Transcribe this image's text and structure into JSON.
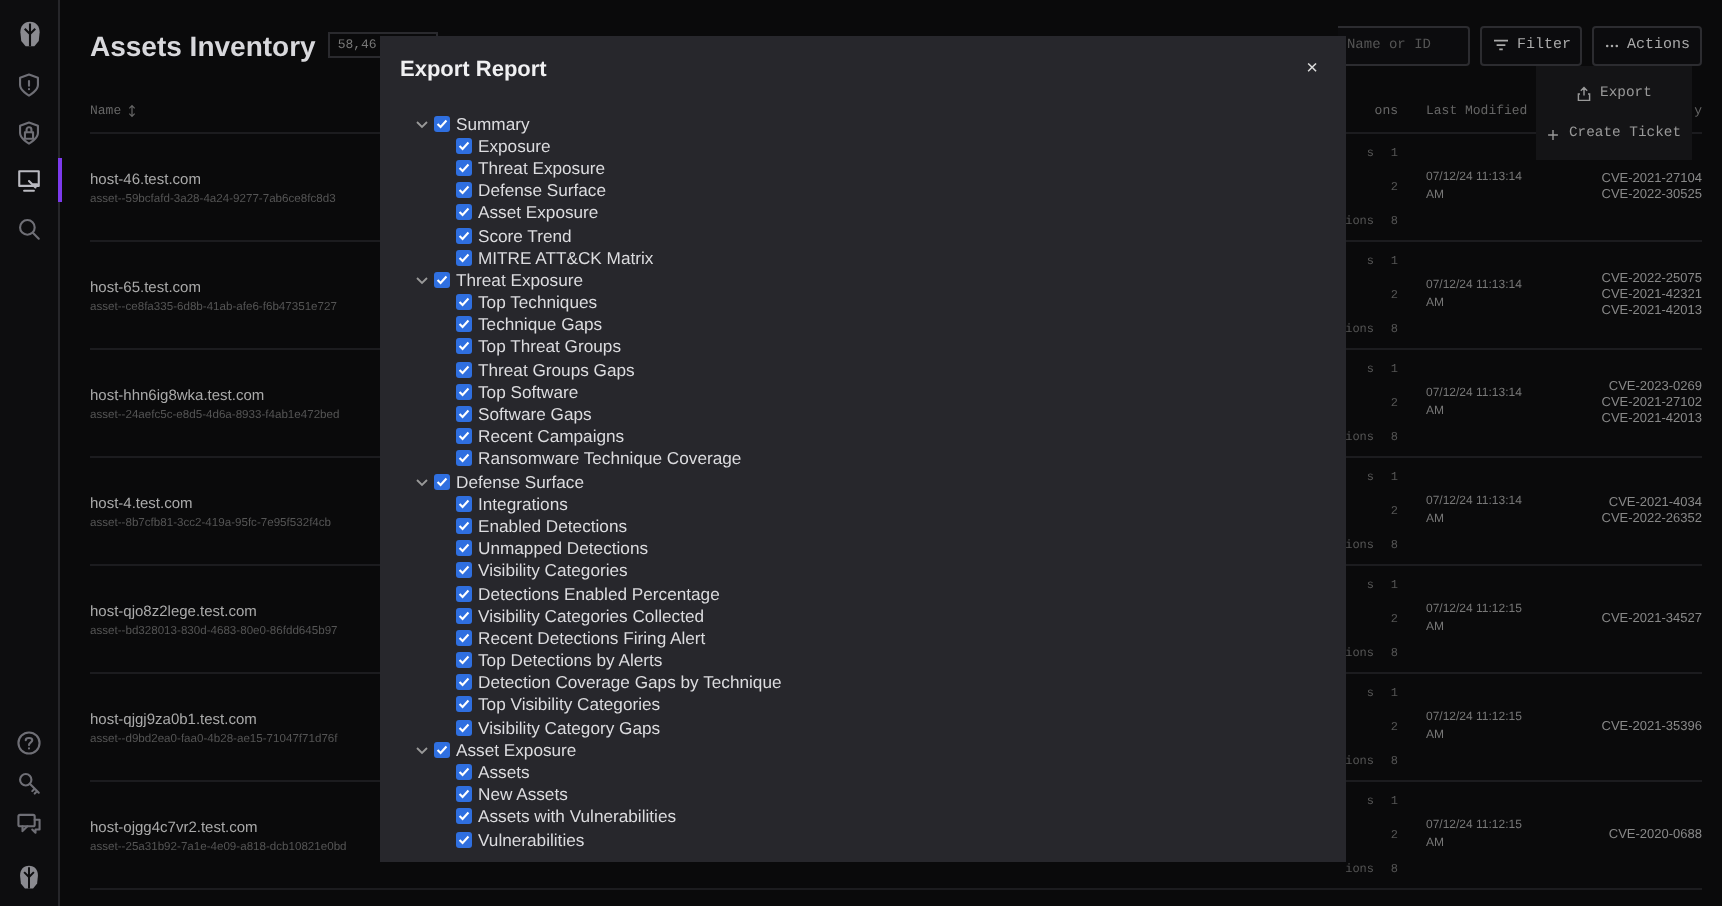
{
  "sidebar": {
    "items": [
      {
        "selected": false
      },
      {
        "selected": false
      },
      {
        "selected": true
      },
      {
        "selected": false
      }
    ]
  },
  "header": {
    "title": "Assets Inventory",
    "count_badge": "58,46",
    "search": {
      "placeholder": "Name or ID"
    },
    "filter_button": "Filter",
    "actions_button": "Actions"
  },
  "actions_menu": {
    "items": [
      {
        "kind": "export",
        "label": "Export"
      },
      {
        "kind": "create",
        "label": "Create Ticket"
      }
    ]
  },
  "table": {
    "columns": [
      {
        "label": "Name",
        "sortable": true
      },
      {
        "label": "ons"
      },
      {
        "label": "Last Modified"
      },
      {
        "label": "y"
      }
    ],
    "rows": [
      {
        "name": "host-46.test.com",
        "asset_id": "asset--59bcfafd-3a28-4a24-9277-7ab6ce8fc8d3",
        "column_2": [
          {
            "label": "s",
            "count": "1"
          },
          {
            "count": "2"
          },
          {
            "label": "ions",
            "count": "8"
          }
        ],
        "last_modified": "07/12/24 11:13:14 AM",
        "cves": [
          "CVE-2021-27104",
          "CVE-2022-30525"
        ]
      },
      {
        "name": "host-65.test.com",
        "asset_id": "asset--ce8fa335-6d8b-41ab-afe6-f6b47351e727",
        "column_2": [
          {
            "label": "s",
            "count": "1"
          },
          {
            "count": "2"
          },
          {
            "label": "ions",
            "count": "8"
          }
        ],
        "last_modified": "07/12/24 11:13:14 AM",
        "cves": [
          "CVE-2022-25075",
          "CVE-2021-42321",
          "CVE-2021-42013"
        ]
      },
      {
        "name": "host-hhn6ig8wka.test.com",
        "asset_id": "asset--24aefc5c-e8d5-4d6a-8933-f4ab1e472bed",
        "column_2": [
          {
            "label": "s",
            "count": "1"
          },
          {
            "count": "2"
          },
          {
            "label": "ions",
            "count": "8"
          }
        ],
        "last_modified": "07/12/24 11:13:14 AM",
        "cves": [
          "CVE-2023-0269",
          "CVE-2021-27102",
          "CVE-2021-42013"
        ]
      },
      {
        "name": "host-4.test.com",
        "asset_id": "asset--8b7cfb81-3cc2-419a-95fc-7e95f532f4cb",
        "column_2": [
          {
            "label": "s",
            "count": "1"
          },
          {
            "count": "2"
          },
          {
            "label": "ions",
            "count": "8"
          }
        ],
        "last_modified": "07/12/24 11:13:14 AM",
        "cves": [
          "CVE-2021-4034",
          "CVE-2022-26352"
        ]
      },
      {
        "name": "host-qjo8z2lege.test.com",
        "asset_id": "asset--bd328013-830d-4683-80e0-86fdd645b97",
        "column_2": [
          {
            "label": "s",
            "count": "1"
          },
          {
            "count": "2"
          },
          {
            "label": "ions",
            "count": "8"
          }
        ],
        "last_modified": "07/12/24 11:12:15 AM",
        "cves": [
          "CVE-2021-34527"
        ]
      },
      {
        "name": "host-qjgj9za0b1.test.com",
        "asset_id": "asset--d9bd2ea0-faa0-4b28-ae15-71047f71d76f",
        "column_2": [
          {
            "label": "s",
            "count": "1"
          },
          {
            "count": "2"
          },
          {
            "label": "ions",
            "count": "8"
          }
        ],
        "last_modified": "07/12/24 11:12:15 AM",
        "cves": [
          "CVE-2021-35396"
        ]
      },
      {
        "name": "host-ojgg4c7vr2.test.com",
        "asset_id": "asset--25a31b92-7a1e-4e09-a818-dcb10821e0bd",
        "column_2": [
          {
            "label": "s",
            "count": "1"
          },
          {
            "count": "2"
          },
          {
            "label": "ions",
            "count": "8"
          }
        ],
        "last_modified": "07/12/24 11:12:15 AM",
        "cves": [
          "CVE-2020-0688"
        ]
      }
    ]
  },
  "modal": {
    "title": "Export Report",
    "close": "×",
    "sections": [
      {
        "label": "Summary",
        "checked": true,
        "expanded": true,
        "children": [
          {
            "label": "Exposure",
            "checked": true
          },
          {
            "label": "Threat Exposure",
            "checked": true
          },
          {
            "label": "Defense Surface",
            "checked": true
          },
          {
            "label": "Asset Exposure",
            "checked": true
          },
          {
            "label": "Score Trend",
            "checked": true
          },
          {
            "label": "MITRE ATT&CK Matrix",
            "checked": true
          }
        ]
      },
      {
        "label": "Threat Exposure",
        "checked": true,
        "expanded": true,
        "children": [
          {
            "label": "Top Techniques",
            "checked": true
          },
          {
            "label": "Technique Gaps",
            "checked": true
          },
          {
            "label": "Top Threat Groups",
            "checked": true
          },
          {
            "label": "Threat Groups Gaps",
            "checked": true
          },
          {
            "label": "Top Software",
            "checked": true
          },
          {
            "label": "Software Gaps",
            "checked": true
          },
          {
            "label": "Recent Campaigns",
            "checked": true
          },
          {
            "label": "Ransomware Technique Coverage",
            "checked": true
          }
        ]
      },
      {
        "label": "Defense Surface",
        "checked": true,
        "expanded": true,
        "children": [
          {
            "label": "Integrations",
            "checked": true
          },
          {
            "label": "Enabled Detections",
            "checked": true
          },
          {
            "label": "Unmapped Detections",
            "checked": true
          },
          {
            "label": "Visibility Categories",
            "checked": true
          },
          {
            "label": "Detections Enabled Percentage",
            "checked": true
          },
          {
            "label": "Visibility Categories Collected",
            "checked": true
          },
          {
            "label": "Recent Detections Firing Alert",
            "checked": true
          },
          {
            "label": "Top Detections by Alerts",
            "checked": true
          },
          {
            "label": "Detection Coverage Gaps by Technique",
            "checked": true
          },
          {
            "label": "Top Visibility Categories",
            "checked": true
          },
          {
            "label": "Visibility Category Gaps",
            "checked": true
          }
        ]
      },
      {
        "label": "Asset Exposure",
        "checked": true,
        "expanded": true,
        "children": [
          {
            "label": "Assets",
            "checked": true
          },
          {
            "label": "New Assets",
            "checked": true
          },
          {
            "label": "Assets with Vulnerabilities",
            "checked": true
          },
          {
            "label": "Vulnerabilities",
            "checked": true
          }
        ]
      }
    ]
  }
}
